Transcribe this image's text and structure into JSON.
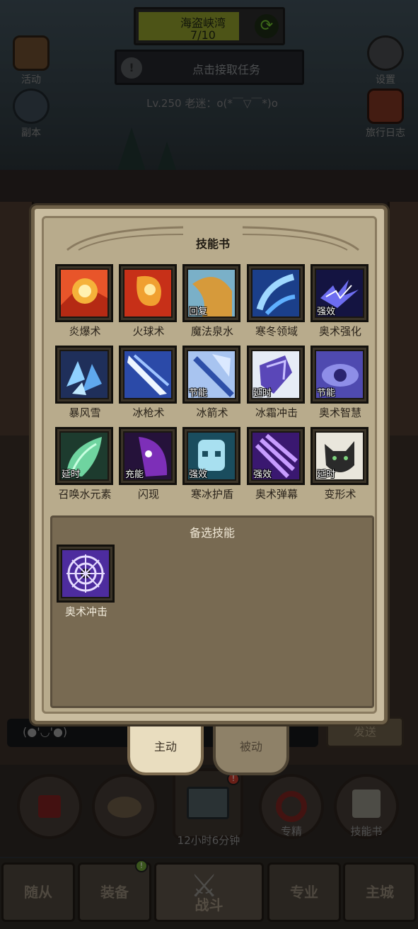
{
  "hud": {
    "pirate_title": "海盗峡湾",
    "pirate_progress": "7/10",
    "task_label": "点击接取任务",
    "level_text": "Lv.250 老迷：o(*￣▽￣*)o",
    "left_buttons": [
      {
        "label": "活动",
        "icon": "event-book-icon"
      },
      {
        "label": "副本",
        "icon": "dungeon-icon"
      }
    ],
    "right_buttons": [
      {
        "label": "设置",
        "icon": "gear-icon"
      },
      {
        "label": "旅行日志",
        "icon": "journal-icon"
      }
    ]
  },
  "dialog": {
    "title": "技能书",
    "skills": [
      {
        "name": "炎爆术",
        "tag": "",
        "color": "#e8552a"
      },
      {
        "name": "火球术",
        "tag": "",
        "color": "#d9431f"
      },
      {
        "name": "魔法泉水",
        "tag": "回复",
        "color": "#d69a3b"
      },
      {
        "name": "寒冬领域",
        "tag": "",
        "color": "#2f6fd0"
      },
      {
        "name": "奥术强化",
        "tag": "强效",
        "color": "#2c2c7a"
      },
      {
        "name": "暴风雪",
        "tag": "",
        "color": "#3f6fc4"
      },
      {
        "name": "冰枪术",
        "tag": "",
        "color": "#3b57b5"
      },
      {
        "name": "冰箭术",
        "tag": "节能",
        "color": "#3d64b6"
      },
      {
        "name": "冰霜冲击",
        "tag": "延时",
        "color": "#4a3ea0"
      },
      {
        "name": "奥术智慧",
        "tag": "节能",
        "color": "#5b55b8"
      },
      {
        "name": "召唤水元素",
        "tag": "延时",
        "color": "#2f9a74"
      },
      {
        "name": "闪现",
        "tag": "充能",
        "color": "#6d2aa0"
      },
      {
        "name": "寒冰护盾",
        "tag": "强效",
        "color": "#2e8ea8"
      },
      {
        "name": "奥术弹幕",
        "tag": "强效",
        "color": "#6730b0"
      },
      {
        "name": "变形术",
        "tag": "延时",
        "color": "#e8e4d8"
      }
    ],
    "alternate_title": "备选技能",
    "alternate": [
      {
        "name": "奥术冲击",
        "tag": "",
        "color": "#5a34b0"
      }
    ]
  },
  "chat": {
    "placeholder": "(●'◡'●)",
    "send_label": "发送"
  },
  "tabs": {
    "active_label": "主动",
    "passive_label": "被动"
  },
  "shelf": {
    "timer": "12小时6分钟",
    "mastery_label": "专精",
    "skillbook_label": "技能书",
    "chest_badge": "!"
  },
  "nav": {
    "items": [
      "随从",
      "装备",
      "战斗",
      "专业",
      "主城"
    ],
    "badge": "!"
  }
}
